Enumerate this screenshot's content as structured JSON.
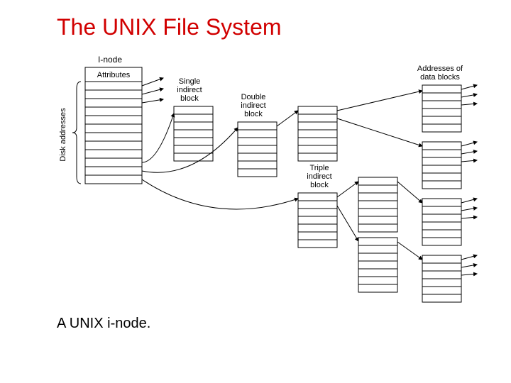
{
  "title": "The UNIX File System",
  "caption": "A UNIX i-node.",
  "labels": {
    "inode": "I-node",
    "attributes": "Attributes",
    "disk_addresses": "Disk addresses",
    "single_indirect_l1": "Single",
    "single_indirect_l2": "indirect",
    "single_indirect_l3": "block",
    "double_indirect_l1": "Double",
    "double_indirect_l2": "indirect",
    "double_indirect_l3": "block",
    "triple_indirect_l1": "Triple",
    "triple_indirect_l2": "indirect",
    "triple_indirect_l3": "block",
    "addresses_of_l1": "Addresses of",
    "addresses_of_l2": "data blocks"
  },
  "diagram": {
    "inode_rows": 13,
    "indirect_block_rows": 7,
    "data_block_group_rows": 6,
    "data_block_groups": 4
  }
}
